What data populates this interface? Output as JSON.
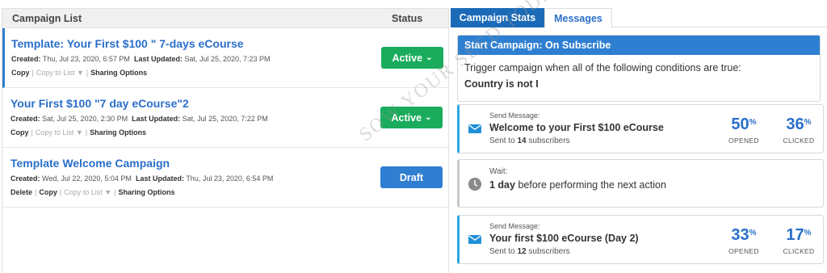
{
  "left_panel": {
    "header_list": "Campaign List",
    "header_status": "Status",
    "campaigns": [
      {
        "title": "Template: Your First $100 \" 7-days eCourse",
        "created_label": "Created:",
        "created": "Thu, Jul 23, 2020, 6:57 PM",
        "updated_label": "Last Updated:",
        "updated": "Sat, Jul 25, 2020, 7:23 PM",
        "action_copy": "Copy",
        "action_copy_to_list": "Copy to List",
        "action_sharing": "Sharing Options",
        "status": "Active"
      },
      {
        "title": "Your First $100 \"7 day eCourse\"2",
        "created_label": "Created:",
        "created": "Sat, Jul 25, 2020, 2:30 PM",
        "updated_label": "Last Updated:",
        "updated": "Sat, Jul 25, 2020, 7:22 PM",
        "action_copy": "Copy",
        "action_copy_to_list": "Copy to List",
        "action_sharing": "Sharing Options",
        "status": "Active"
      },
      {
        "title": "Template Welcome Campaign",
        "created_label": "Created:",
        "created": "Wed, Jul 22, 2020, 5:04 PM",
        "updated_label": "Last Updated:",
        "updated": "Thu, Jul 23, 2020, 6:54 PM",
        "action_delete": "Delete",
        "action_copy": "Copy",
        "action_copy_to_list": "Copy to List",
        "action_sharing": "Sharing Options",
        "status": "Draft"
      }
    ],
    "chevron_glyph": "⌄",
    "dropdown_glyph": "▼",
    "separator": "|"
  },
  "right_panel": {
    "tabs": [
      "Campaign Stats",
      "Messages"
    ],
    "trigger": {
      "head_prefix": "Start Campaign:",
      "head_value": "On Subscribe",
      "line1": "Trigger campaign when all of the following conditions are true:",
      "line2": "Country is not I"
    },
    "steps": [
      {
        "label": "Send Message:",
        "subject": "Welcome to your First $100 eCourse",
        "sent_prefix": "Sent to",
        "sent_count": "14",
        "sent_suffix": "subscribers",
        "opened": "50",
        "opened_label": "OPENED",
        "clicked": "36",
        "clicked_label": "CLICKED",
        "pct": "%"
      },
      {
        "label": "Wait:",
        "duration": "1 day",
        "text": "before performing the next action"
      },
      {
        "label": "Send Message:",
        "subject": "Your first $100 eCourse (Day 2)",
        "sent_prefix": "Sent to",
        "sent_count": "12",
        "sent_suffix": "subscribers",
        "opened": "33",
        "opened_label": "OPENED",
        "clicked": "17",
        "clicked_label": "CLICKED",
        "pct": "%"
      }
    ]
  },
  "watermark": "SOW YOUR SEED TODAY",
  "colors": {
    "active": "#1aac5c",
    "draft": "#2f7ed1",
    "tab_active": "#1a6ab8",
    "link_blue": "#2a6fc9",
    "accent_cyan": "#27a7e0"
  }
}
